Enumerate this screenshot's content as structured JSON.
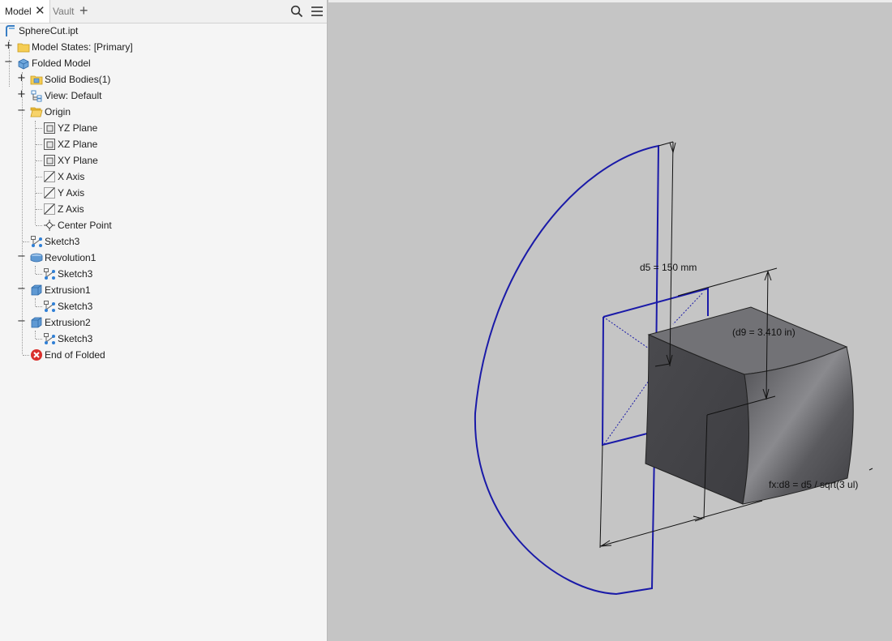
{
  "tabs": {
    "model": "Model",
    "vault": "Vault",
    "add": "+"
  },
  "tree": {
    "items": [
      {
        "label": "SphereCut.ipt",
        "icon": "part-file-icon"
      },
      {
        "label": "Model States: [Primary]",
        "icon": "folder-icon"
      },
      {
        "label": "Folded Model",
        "icon": "folded-model-icon"
      },
      {
        "label": "Solid Bodies(1)",
        "icon": "solid-bodies-folder-icon"
      },
      {
        "label": "View: Default",
        "icon": "view-icon"
      },
      {
        "label": "Origin",
        "icon": "open-folder-icon"
      },
      {
        "label": "YZ Plane",
        "icon": "plane-icon"
      },
      {
        "label": "XZ Plane",
        "icon": "plane-icon"
      },
      {
        "label": "XY Plane",
        "icon": "plane-icon"
      },
      {
        "label": "X Axis",
        "icon": "axis-icon"
      },
      {
        "label": "Y Axis",
        "icon": "axis-icon"
      },
      {
        "label": "Z Axis",
        "icon": "axis-icon"
      },
      {
        "label": "Center Point",
        "icon": "center-point-icon"
      },
      {
        "label": "Sketch3",
        "icon": "sketch-icon"
      },
      {
        "label": "Revolution1",
        "icon": "revolution-icon"
      },
      {
        "label": "Sketch3",
        "icon": "sketch-icon"
      },
      {
        "label": "Extrusion1",
        "icon": "extrusion-icon"
      },
      {
        "label": "Sketch3",
        "icon": "sketch-icon"
      },
      {
        "label": "Extrusion2",
        "icon": "extrusion-icon"
      },
      {
        "label": "Sketch3",
        "icon": "sketch-icon"
      },
      {
        "label": "End of Folded",
        "icon": "end-of-part-icon"
      }
    ]
  },
  "viewport": {
    "dim_d5": "d5 = 150 mm",
    "dim_d9": "(d9 = 3.410 in)",
    "dim_d8": "fx:d8 = d5 / sqrt(3 ul)"
  },
  "colors": {
    "sketch": "#1a1aa8",
    "background": "#c5c5c5",
    "body": "#5e5e62"
  }
}
